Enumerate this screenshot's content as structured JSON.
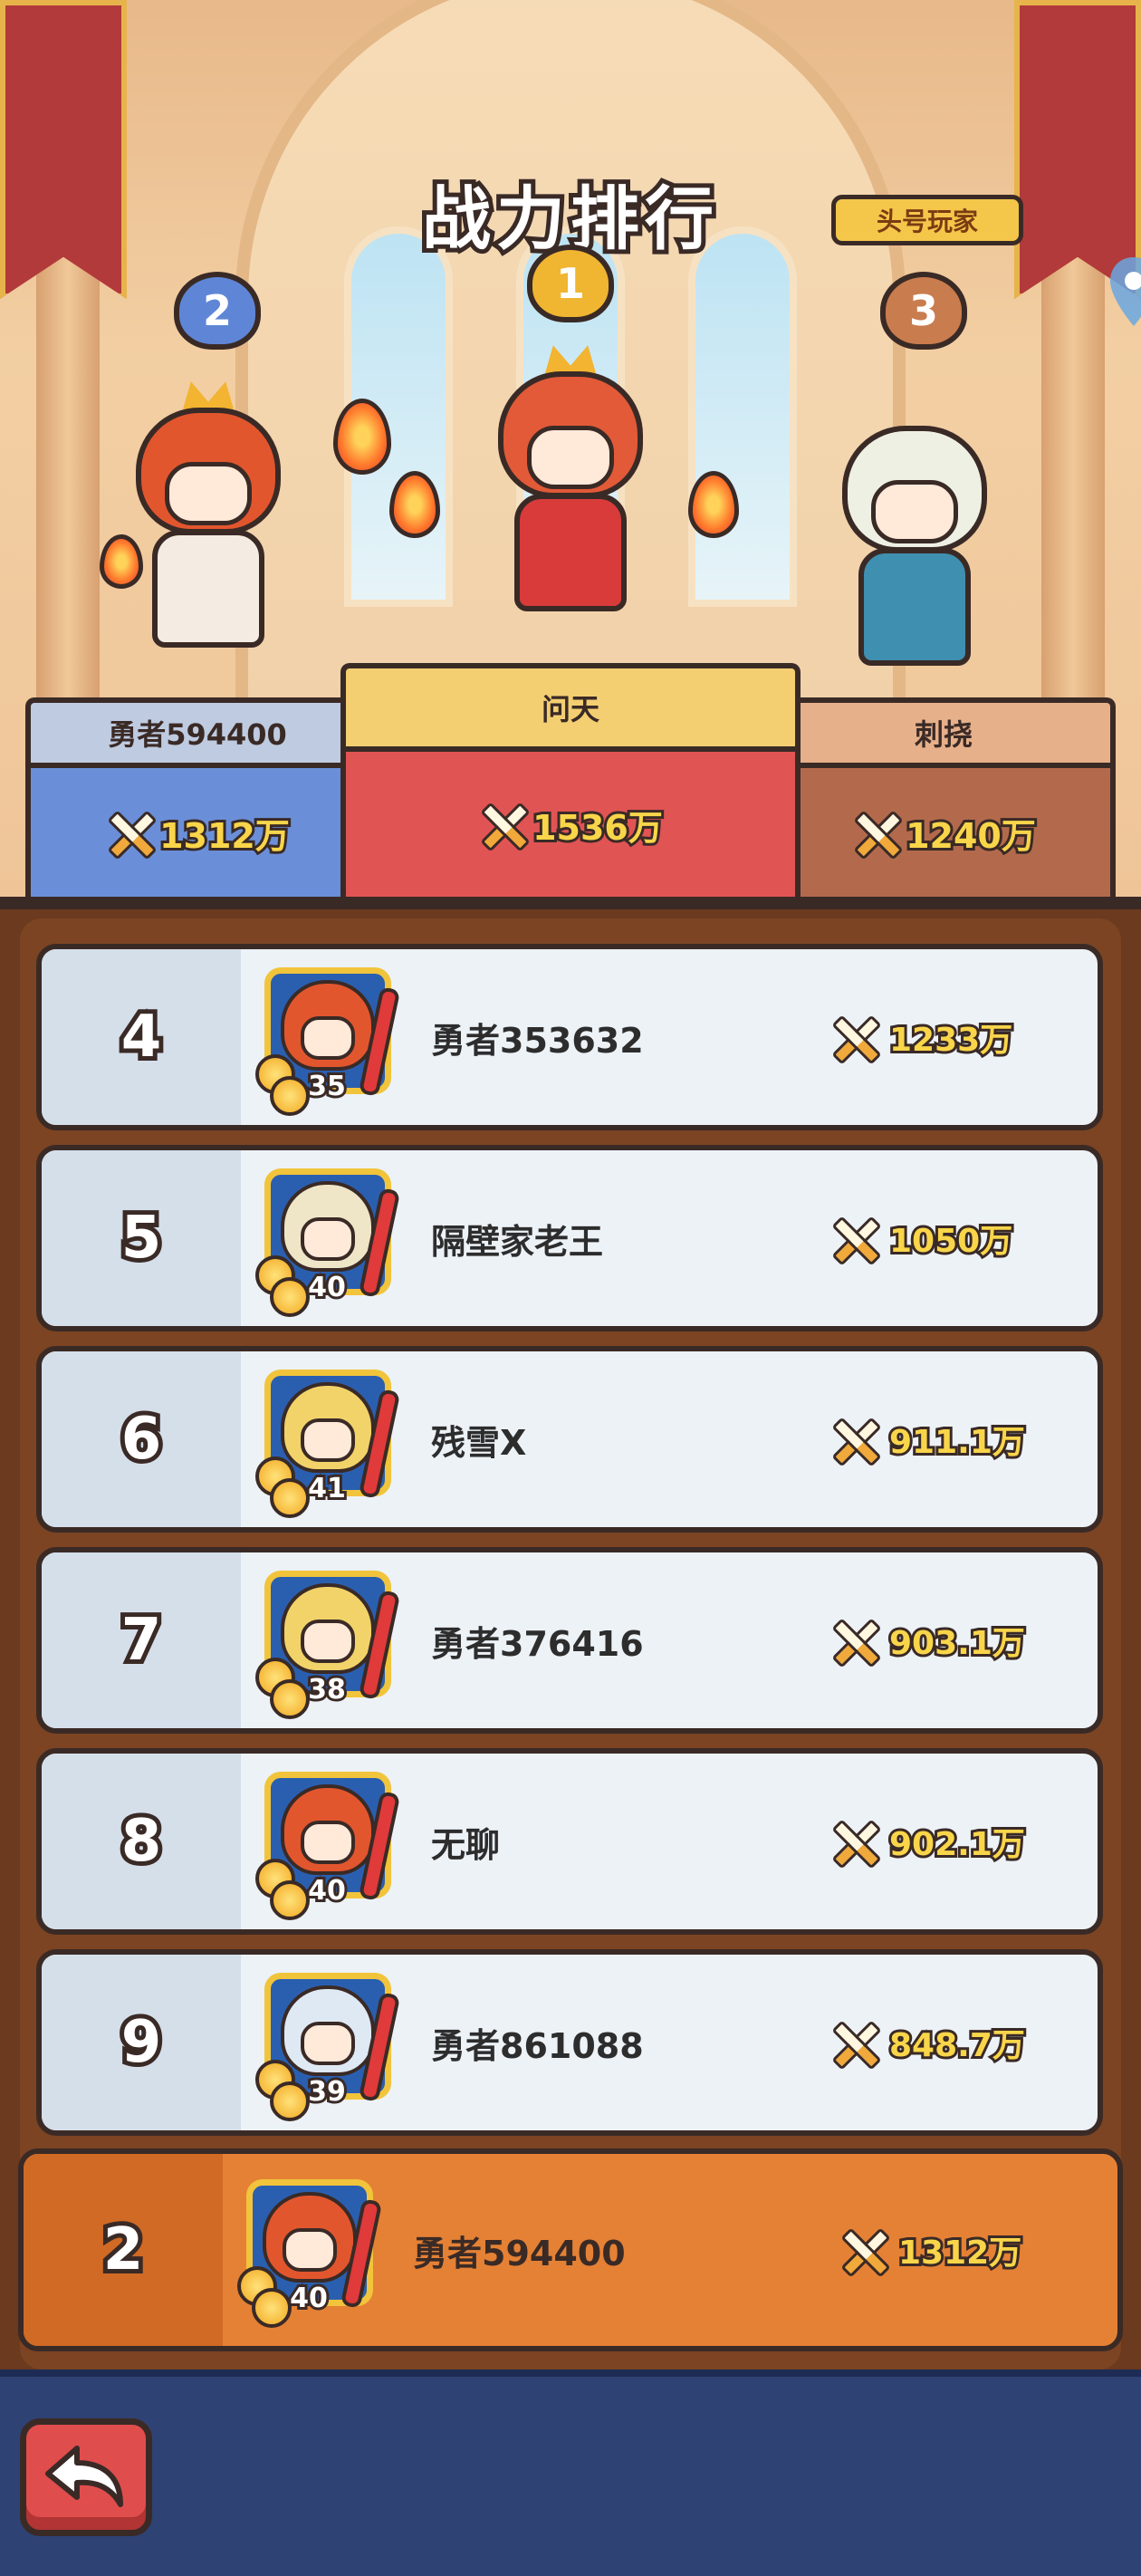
{
  "screen": {
    "title": "战力排行"
  },
  "podium": {
    "top_player_badge": "头号玩家",
    "first": {
      "rank": "1",
      "name": "问天",
      "power": "1536万",
      "accent": "#e15454"
    },
    "second": {
      "rank": "2",
      "name": "勇者594400",
      "power": "1312万",
      "accent": "#6a8fd8"
    },
    "third": {
      "rank": "3",
      "name": "刺挠",
      "power": "1240万",
      "accent": "#b36a4c"
    }
  },
  "ranking": [
    {
      "rank": "4",
      "name": "勇者353632",
      "level": "35",
      "power": "1233万"
    },
    {
      "rank": "5",
      "name": "隔壁家老王",
      "level": "40",
      "power": "1050万"
    },
    {
      "rank": "6",
      "name": "残雪X",
      "level": "41",
      "power": "911.1万"
    },
    {
      "rank": "7",
      "name": "勇者376416",
      "level": "38",
      "power": "903.1万"
    },
    {
      "rank": "8",
      "name": "无聊",
      "level": "40",
      "power": "902.1万"
    },
    {
      "rank": "9",
      "name": "勇者861088",
      "level": "39",
      "power": "848.7万"
    }
  ],
  "my_rank": {
    "rank": "2",
    "name": "勇者594400",
    "level": "40",
    "power": "1312万"
  },
  "icons": {
    "power": "crossed-swords-icon",
    "back": "back-arrow-icon",
    "location": "map-pin-icon"
  },
  "colors": {
    "gold": "#f9d54a",
    "outline": "#3a2a26",
    "my_row": "#e58135"
  }
}
